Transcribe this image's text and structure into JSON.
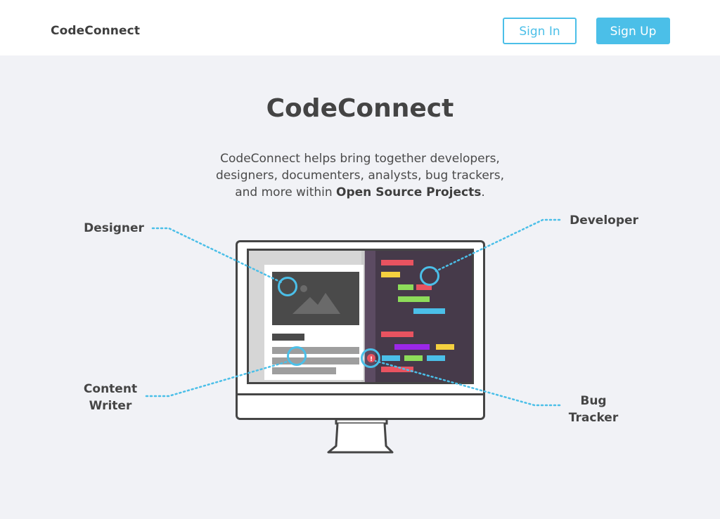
{
  "header": {
    "brand": "CodeConnect",
    "sign_in_label": "Sign In",
    "sign_up_label": "Sign Up"
  },
  "hero": {
    "title": "CodeConnect",
    "description_line1": "CodeConnect helps bring together developers,",
    "description_line2": "designers, documenters, analysts, bug trackers,",
    "description_line3_prefix": "and more within ",
    "description_emphasis": "Open Source Projects",
    "description_line3_suffix": "."
  },
  "roles": {
    "designer": "Designer",
    "developer": "Developer",
    "content_writer_line1": "Content",
    "content_writer_line2": "Writer",
    "bug_tracker_line1": "Bug",
    "bug_tracker_line2": "Tracker"
  },
  "colors": {
    "accent": "#4bbfe8",
    "background": "#f1f2f6",
    "code_panel": "#463a4a",
    "code_red": "#e95360",
    "code_yellow": "#f4d03f",
    "code_green": "#8ddc5a",
    "code_blue": "#4bbfe8",
    "code_purple": "#9b27e8"
  },
  "illustration": {
    "bug_marker": "!"
  }
}
